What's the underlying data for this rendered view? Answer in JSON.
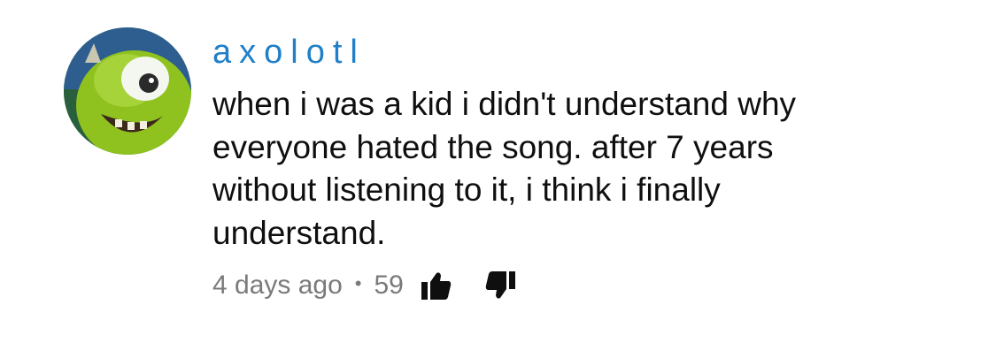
{
  "comment": {
    "author": "axolotl",
    "text": "when i was a kid i didn't understand why everyone hated the song. after 7 years without listening to it, i think i finally understand.",
    "time": "4 days ago",
    "separator": "•",
    "likes": "59",
    "avatar_icon": "monster-avatar-icon",
    "like_icon": "thumbs-up-icon",
    "dislike_icon": "thumbs-down-icon"
  },
  "colors": {
    "author": "#1f7fc8",
    "text": "#0f0f0f",
    "meta": "#7a7a7a",
    "icon": "#0f0f0f",
    "background": "#ffffff"
  }
}
